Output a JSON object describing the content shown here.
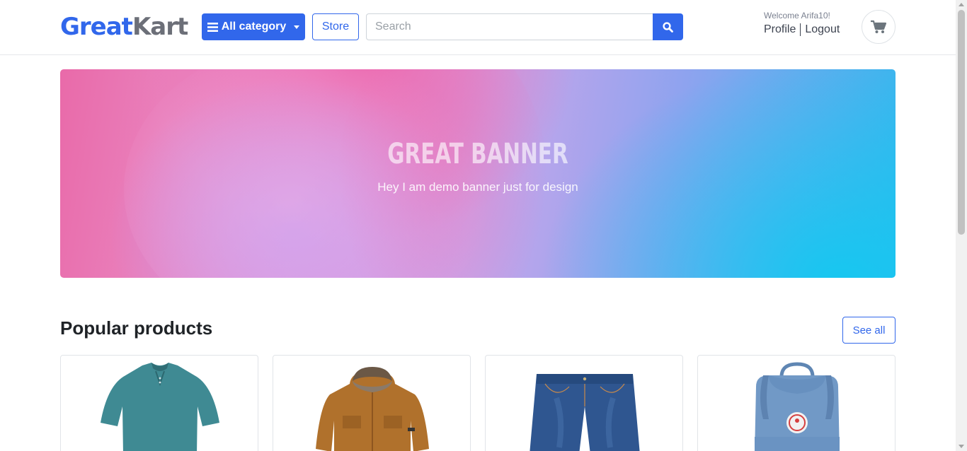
{
  "header": {
    "logo_part1": "Great",
    "logo_part2": "Kart",
    "category_button": "All category",
    "store_button": "Store",
    "search_placeholder": "Search",
    "welcome_text": "Welcome Arifa10!",
    "profile_link": "Profile",
    "logout_link": "Logout"
  },
  "banner": {
    "title": "GREAT BANNER",
    "subtitle": "Hey I am demo banner just for design"
  },
  "popular": {
    "title": "Popular products",
    "see_all": "See all",
    "products": [
      {
        "icon": "polo-shirt-image"
      },
      {
        "icon": "jacket-image"
      },
      {
        "icon": "jeans-shorts-image"
      },
      {
        "icon": "backpack-image"
      }
    ]
  },
  "colors": {
    "brand": "#3167eb",
    "logo_grey": "#6c6f78"
  }
}
